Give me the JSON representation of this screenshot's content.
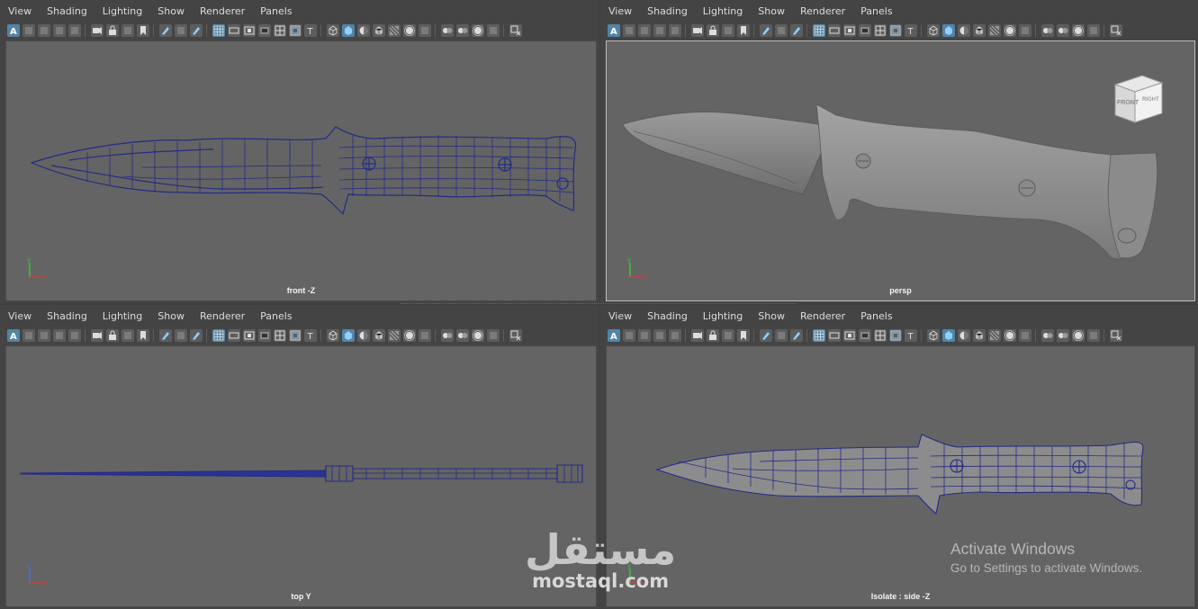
{
  "menus": [
    "View",
    "Shading",
    "Lighting",
    "Show",
    "Renderer",
    "Panels"
  ],
  "panels": [
    {
      "camera": "front -Z",
      "axis": [
        "y",
        "x"
      ]
    },
    {
      "camera": "persp",
      "axis": [
        "y",
        "x"
      ],
      "viewcube": {
        "front": "FRONT",
        "right": "RIGHT"
      }
    },
    {
      "camera": "top Y",
      "axis": [
        "z",
        "x"
      ]
    },
    {
      "camera": "Isolate : side -Z",
      "axis": [
        "y",
        "x"
      ]
    }
  ],
  "toolbar_icons": [
    "camera-icon",
    "lock-camera-icon",
    "bookmark-icon",
    "grease-pencil-icon",
    "grid-icon",
    "film-gate-icon",
    "resolution-gate-icon",
    "gate-mask-icon",
    "field-chart-icon",
    "safe-action-icon",
    "safe-title-icon",
    "wireframe-icon",
    "smooth-shade-icon",
    "default-lighting-icon",
    "textured-icon",
    "shadows-icon",
    "ambient-occlusion-icon",
    "anti-aliasing-icon",
    "isolate-select-icon"
  ],
  "watermark": {
    "logo": "مستقل",
    "site": "mostaql.com"
  },
  "activation": {
    "title": "Activate Windows",
    "subtitle": "Go to Settings to activate Windows."
  },
  "colors": {
    "wire": "#232b86",
    "viewport": "#646464",
    "panel": "#444444",
    "active_icon": "#5285a6",
    "mesh_fill": "#8c8c8c"
  }
}
